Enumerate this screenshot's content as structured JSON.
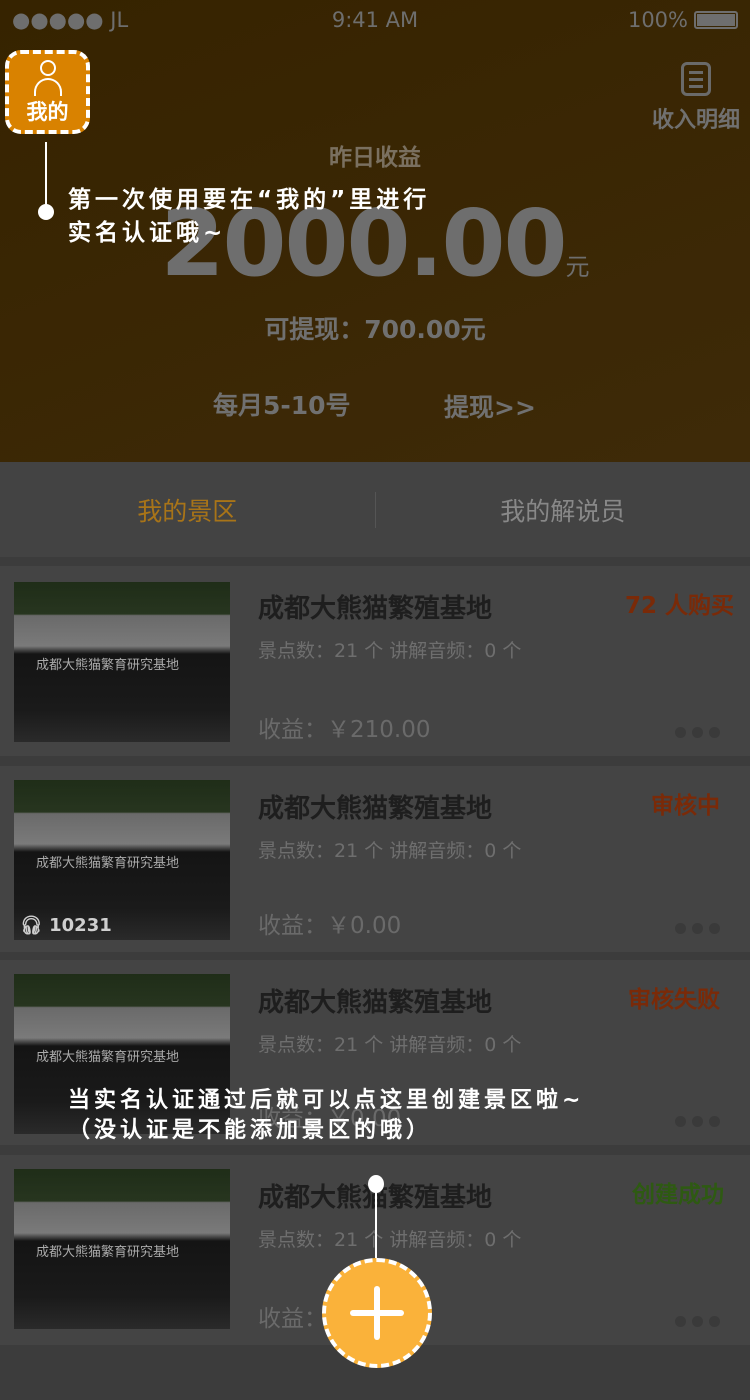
{
  "status_bar": {
    "carrier": "●●●●● JL",
    "time": "9:41 AM",
    "battery": "100%"
  },
  "header": {
    "income_detail_label": "收入明细",
    "yesterday_label": "昨日收益",
    "yesterday_amount": "2000.00",
    "currency_unit": "元",
    "withdrawable": "可提现：700.00元",
    "withdraw_schedule": "每月5-10号",
    "withdraw_link": "提现>>"
  },
  "tabs": [
    {
      "label": "我的景区",
      "active": true
    },
    {
      "label": "我的解说员",
      "active": false
    }
  ],
  "cards": [
    {
      "name": "成都大熊猫繁殖基地",
      "meta": "景点数：21 个 讲解音频：0 个",
      "income": "收益：￥210.00",
      "status": "72 人购买",
      "status_color": "#c0400a",
      "image_sign": "成都大熊猫繁育研究基地"
    },
    {
      "name": "成都大熊猫繁殖基地",
      "meta": "景点数：21 个 讲解音频：0 个",
      "income": "收益：￥0.00",
      "status": "审核中",
      "status_color": "#c0400a",
      "listen_count": "10231",
      "image_sign": "成都大熊猫繁育研究基地"
    },
    {
      "name": "成都大熊猫繁殖基地",
      "meta": "景点数：21 个 讲解音频：0 个",
      "income": "收益：￥0.00",
      "status": "审核失败",
      "status_color": "#c0400a",
      "image_sign": "成都大熊猫繁育研究基地"
    },
    {
      "name": "成都大熊猫繁殖基地",
      "meta": "景点数：21 个 讲解音频：0 个",
      "income": "收益：",
      "status": "创建成功",
      "status_color": "#3f8a1a",
      "image_sign": "成都大熊猫繁育研究基地"
    }
  ],
  "guide": {
    "mine_label": "我的",
    "tip1_line1": "第一次使用要在“我的”里进行",
    "tip1_line2": "实名认证哦~",
    "tip2_line1": "当实名认证通过后就可以点这里创建景区啦~",
    "tip2_line2": "（没认证是不能添加景区的哦）"
  },
  "colors": {
    "accent": "#f7a800",
    "fab": "#fab23a"
  }
}
